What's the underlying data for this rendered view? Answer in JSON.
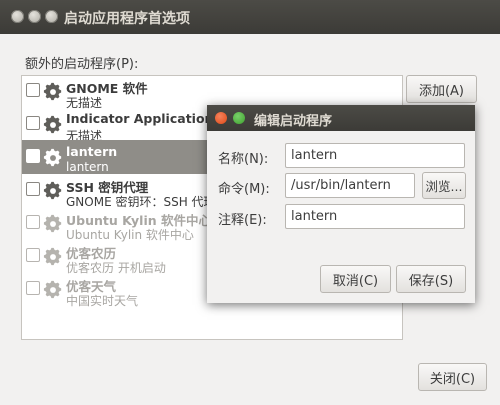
{
  "window": {
    "title": "启动应用程序首选项",
    "section_label": "额外的启动程序(P):",
    "add_button": "添加(A)",
    "close_button": "关闭(C)"
  },
  "startup_items": [
    {
      "name": "GNOME 软件",
      "description": "无描述",
      "checked": false,
      "enabled": true
    },
    {
      "name": "Indicator Application",
      "description": "无描述",
      "checked": false,
      "enabled": true
    },
    {
      "name": "lantern",
      "description": "lantern",
      "checked": false,
      "enabled": true,
      "selected": true
    },
    {
      "name": "SSH 密钥代理",
      "description": "GNOME 密钥环：SSH 代理",
      "checked": false,
      "enabled": true
    },
    {
      "name": "Ubuntu Kylin 软件中心",
      "description": "Ubuntu Kylin 软件中心",
      "checked": false,
      "enabled": false
    },
    {
      "name": "优客农历",
      "description": "优客农历 开机启动",
      "checked": false,
      "enabled": false
    },
    {
      "name": "优客天气",
      "description": "中国实时天气",
      "checked": false,
      "enabled": false
    }
  ],
  "dialog": {
    "title": "编辑启动程序",
    "name_label": "名称(N):",
    "name_value": "lantern",
    "command_label": "命令(M):",
    "command_value": "/usr/bin/lantern",
    "browse_button": "浏览...",
    "comment_label": "注释(E):",
    "comment_value": "lantern",
    "cancel_button": "取消(C)",
    "save_button": "保存(S)"
  },
  "colors": {
    "titlebar": "#3c3b37",
    "selection": "#8f8d88",
    "close_dot": "#df4a16",
    "max_dot": "#3fa22f"
  },
  "icons": [
    "gear-icon",
    "window-close-icon",
    "window-maximize-icon"
  ]
}
